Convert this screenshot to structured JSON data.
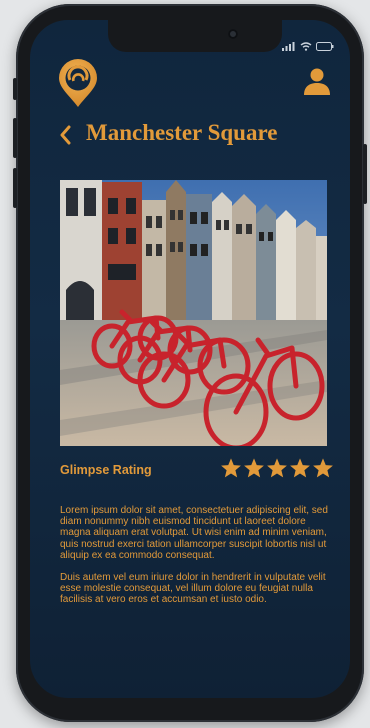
{
  "header": {
    "title": "Manchester Square",
    "back_icon": "chevron-left-icon",
    "logo_icon": "location-pin-logo-icon",
    "profile_icon": "user-icon"
  },
  "status_bar": {
    "icons": [
      "signal-icon",
      "wifi-icon",
      "battery-icon"
    ]
  },
  "photo": {
    "description_icon": "red-bike-racks-photo"
  },
  "rating": {
    "label": "Glimpse Rating",
    "stars": 5,
    "max_stars": 5
  },
  "content": {
    "paragraph_1": "Lorem ipsum dolor sit amet, consectetuer adipiscing elit, sed diam nonummy nibh euismod tincidunt ut laoreet dolore magna aliquam erat volutpat. Ut wisi enim ad minim veniam, quis nostrud exerci tation ullamcorper suscipit lobortis nisl ut aliquip ex ea commodo consequat.",
    "paragraph_2": "Duis autem vel eum iriure dolor in hendrerit in vulputate velit esse molestie consequat, vel illum dolore eu feugiat nulla facilisis at vero eros et accumsan et iusto odio."
  },
  "colors": {
    "accent": "#e29a3a",
    "background": "#132b44",
    "bike_red": "#c8232c"
  }
}
